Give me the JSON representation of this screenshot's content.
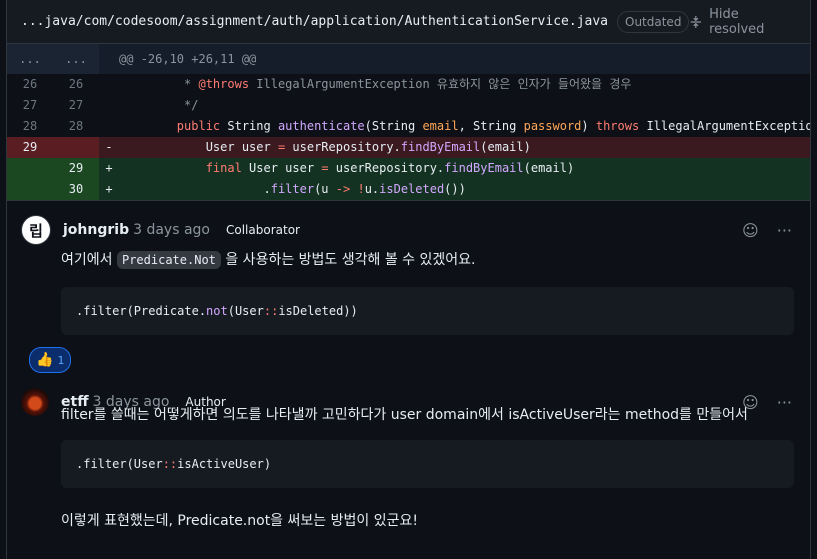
{
  "file": {
    "path": "...java/com/codesoom/assignment/auth/application/AuthenticationService.java",
    "badge": "Outdated",
    "hide_resolved": "Hide resolved"
  },
  "diff": {
    "hunk_left": "...",
    "hunk_right": "...",
    "hunk_header": "@@ -26,10 +26,11 @@",
    "rows": [
      {
        "type": "ctx",
        "old": "26",
        "new": "26",
        "sign": "",
        "tokens": [
          [
            "         * ",
            "cmt"
          ],
          [
            "@throws",
            "cmt-kw"
          ],
          [
            " IllegalArgumentException 유효하지 않은 인자가 들어왔을 경우",
            "cmt"
          ]
        ]
      },
      {
        "type": "ctx",
        "old": "27",
        "new": "27",
        "sign": "",
        "tokens": [
          [
            "         */",
            "cmt"
          ]
        ]
      },
      {
        "type": "ctx",
        "old": "28",
        "new": "28",
        "sign": "",
        "tokens": [
          [
            "        ",
            ""
          ],
          [
            "public",
            "kw"
          ],
          [
            " String ",
            ""
          ],
          [
            "authenticate",
            "fn"
          ],
          [
            "(String ",
            ""
          ],
          [
            "email",
            "var"
          ],
          [
            ", String ",
            ""
          ],
          [
            "password",
            "var"
          ],
          [
            ") ",
            ""
          ],
          [
            "throws",
            "kw"
          ],
          [
            " IllegalArgumentException {",
            ""
          ]
        ]
      },
      {
        "type": "del",
        "old": "29",
        "new": "",
        "sign": "-",
        "tokens": [
          [
            "            User user ",
            ""
          ],
          [
            "=",
            "kw"
          ],
          [
            " userRepository.",
            ""
          ],
          [
            "findByEmail",
            "fn"
          ],
          [
            "(email)",
            ""
          ]
        ]
      },
      {
        "type": "add",
        "old": "",
        "new": "29",
        "sign": "+",
        "tokens": [
          [
            "            ",
            ""
          ],
          [
            "final",
            "kw"
          ],
          [
            " User user ",
            ""
          ],
          [
            "=",
            "kw"
          ],
          [
            " userRepository.",
            ""
          ],
          [
            "findByEmail",
            "fn"
          ],
          [
            "(email)",
            ""
          ]
        ]
      },
      {
        "type": "add",
        "old": "",
        "new": "30",
        "sign": "+",
        "tokens": [
          [
            "                    .",
            ""
          ],
          [
            "filter",
            "fn"
          ],
          [
            "(u ",
            ""
          ],
          [
            "->",
            "kw"
          ],
          [
            " ",
            ""
          ],
          [
            "!",
            "kw"
          ],
          [
            "u.",
            ""
          ],
          [
            "isDeleted",
            "fn"
          ],
          [
            "())",
            ""
          ]
        ]
      }
    ]
  },
  "comments": [
    {
      "avatar_text": "립",
      "author": "johngrib",
      "time": "3 days ago",
      "role": "Collaborator",
      "body_before": "여기에서 ",
      "body_code": "Predicate.Not",
      "body_after": " 을 사용하는 방법도 생각해 볼 수 있겠어요.",
      "code_tokens": [
        [
          ".filter(Predicate.",
          ""
        ],
        [
          "not",
          "fn"
        ],
        [
          "(User",
          ""
        ],
        [
          "::",
          "kw"
        ],
        [
          "isDeleted))",
          ""
        ]
      ],
      "reaction": {
        "emoji": "👍",
        "count": "1"
      }
    },
    {
      "author": "etff",
      "time": "3 days ago",
      "role": "Author",
      "body": "filter를 쓸때는 어떻게하면 의도를 나타낼까 고민하다가 user domain에서 isActiveUser라는 method를 만들어서",
      "code_tokens": [
        [
          ".filter(User",
          ""
        ],
        [
          "::",
          "kw"
        ],
        [
          "isActiveUser)",
          ""
        ]
      ],
      "body2": "이렇게 표현했는데, Predicate.not을 써보는 방법이 있군요!"
    }
  ],
  "icons": {
    "emoji_icon": "☺",
    "more_icon": "···"
  },
  "colors": {
    "deleted_line": "#5a1d22",
    "added_line": "#1b4721",
    "keyword": "#ff7b72",
    "function": "#d2a8ff"
  }
}
